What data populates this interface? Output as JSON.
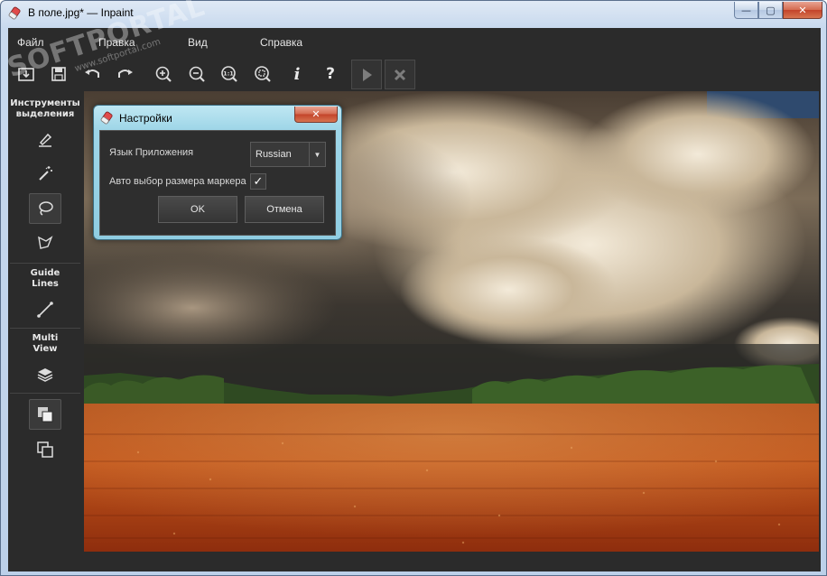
{
  "window": {
    "title": "В поле.jpg* — Inpaint",
    "min_label": "—",
    "max_label": "▢",
    "close_label": "✕"
  },
  "menu": {
    "items": [
      "Файл",
      "Правка",
      "Вид",
      "Справка"
    ]
  },
  "toolbar": {
    "zoom_actual_label": "1:1",
    "info_label": "i",
    "help_label": "?"
  },
  "leftpanel": {
    "selection_tools_label": "Инструменты выделения",
    "guide_lines_label": "Guide Lines",
    "multi_view_label": "Multi View"
  },
  "dialog": {
    "title": "Настройки",
    "close_label": "✕",
    "language_label": "Язык Приложения",
    "language_value": "Russian",
    "auto_marker_label": "Авто выбор размера маркера",
    "auto_marker_checked": "✓",
    "ok_label": "OK",
    "cancel_label": "Отмена"
  },
  "watermark": {
    "brand": "SOFTPORTAL",
    "url": "www.softportal.com"
  },
  "colors": {
    "app_bg": "#2b2b2b",
    "dialog_frame": "#9fd6e8",
    "field": "#c2561c"
  },
  "icons": [
    "open-icon",
    "save-icon",
    "undo-icon",
    "redo-icon",
    "zoom-in-icon",
    "zoom-out-icon",
    "zoom-actual-icon",
    "zoom-fit-icon",
    "info-icon",
    "help-icon",
    "play-icon",
    "stop-icon",
    "marker-icon",
    "magic-wand-icon",
    "lasso-icon",
    "polygon-lasso-icon",
    "line-icon",
    "layers-icon",
    "view-stack-icon",
    "view-copy-icon"
  ]
}
